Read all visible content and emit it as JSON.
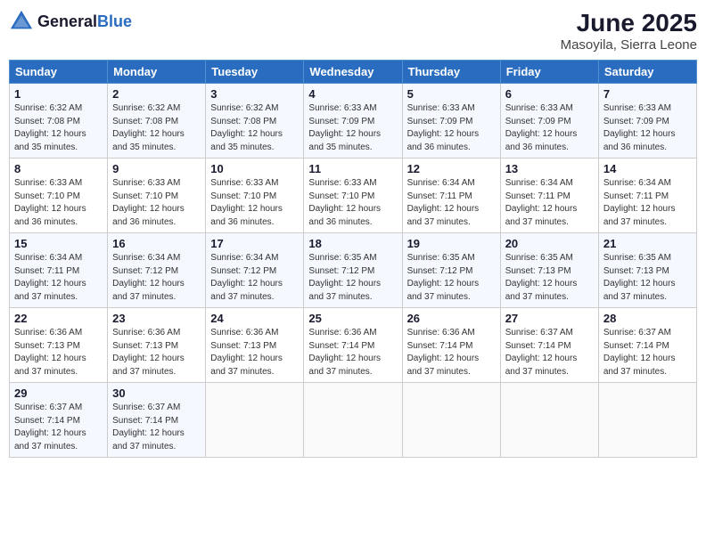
{
  "logo": {
    "general": "General",
    "blue": "Blue"
  },
  "title": "June 2025",
  "subtitle": "Masoyila, Sierra Leone",
  "days_header": [
    "Sunday",
    "Monday",
    "Tuesday",
    "Wednesday",
    "Thursday",
    "Friday",
    "Saturday"
  ],
  "weeks": [
    [
      {
        "day": "1",
        "sunrise": "6:32 AM",
        "sunset": "7:08 PM",
        "daylight": "12 hours and 35 minutes."
      },
      {
        "day": "2",
        "sunrise": "6:32 AM",
        "sunset": "7:08 PM",
        "daylight": "12 hours and 35 minutes."
      },
      {
        "day": "3",
        "sunrise": "6:32 AM",
        "sunset": "7:08 PM",
        "daylight": "12 hours and 35 minutes."
      },
      {
        "day": "4",
        "sunrise": "6:33 AM",
        "sunset": "7:09 PM",
        "daylight": "12 hours and 35 minutes."
      },
      {
        "day": "5",
        "sunrise": "6:33 AM",
        "sunset": "7:09 PM",
        "daylight": "12 hours and 36 minutes."
      },
      {
        "day": "6",
        "sunrise": "6:33 AM",
        "sunset": "7:09 PM",
        "daylight": "12 hours and 36 minutes."
      },
      {
        "day": "7",
        "sunrise": "6:33 AM",
        "sunset": "7:09 PM",
        "daylight": "12 hours and 36 minutes."
      }
    ],
    [
      {
        "day": "8",
        "sunrise": "6:33 AM",
        "sunset": "7:10 PM",
        "daylight": "12 hours and 36 minutes."
      },
      {
        "day": "9",
        "sunrise": "6:33 AM",
        "sunset": "7:10 PM",
        "daylight": "12 hours and 36 minutes."
      },
      {
        "day": "10",
        "sunrise": "6:33 AM",
        "sunset": "7:10 PM",
        "daylight": "12 hours and 36 minutes."
      },
      {
        "day": "11",
        "sunrise": "6:33 AM",
        "sunset": "7:10 PM",
        "daylight": "12 hours and 36 minutes."
      },
      {
        "day": "12",
        "sunrise": "6:34 AM",
        "sunset": "7:11 PM",
        "daylight": "12 hours and 37 minutes."
      },
      {
        "day": "13",
        "sunrise": "6:34 AM",
        "sunset": "7:11 PM",
        "daylight": "12 hours and 37 minutes."
      },
      {
        "day": "14",
        "sunrise": "6:34 AM",
        "sunset": "7:11 PM",
        "daylight": "12 hours and 37 minutes."
      }
    ],
    [
      {
        "day": "15",
        "sunrise": "6:34 AM",
        "sunset": "7:11 PM",
        "daylight": "12 hours and 37 minutes."
      },
      {
        "day": "16",
        "sunrise": "6:34 AM",
        "sunset": "7:12 PM",
        "daylight": "12 hours and 37 minutes."
      },
      {
        "day": "17",
        "sunrise": "6:34 AM",
        "sunset": "7:12 PM",
        "daylight": "12 hours and 37 minutes."
      },
      {
        "day": "18",
        "sunrise": "6:35 AM",
        "sunset": "7:12 PM",
        "daylight": "12 hours and 37 minutes."
      },
      {
        "day": "19",
        "sunrise": "6:35 AM",
        "sunset": "7:12 PM",
        "daylight": "12 hours and 37 minutes."
      },
      {
        "day": "20",
        "sunrise": "6:35 AM",
        "sunset": "7:13 PM",
        "daylight": "12 hours and 37 minutes."
      },
      {
        "day": "21",
        "sunrise": "6:35 AM",
        "sunset": "7:13 PM",
        "daylight": "12 hours and 37 minutes."
      }
    ],
    [
      {
        "day": "22",
        "sunrise": "6:36 AM",
        "sunset": "7:13 PM",
        "daylight": "12 hours and 37 minutes."
      },
      {
        "day": "23",
        "sunrise": "6:36 AM",
        "sunset": "7:13 PM",
        "daylight": "12 hours and 37 minutes."
      },
      {
        "day": "24",
        "sunrise": "6:36 AM",
        "sunset": "7:13 PM",
        "daylight": "12 hours and 37 minutes."
      },
      {
        "day": "25",
        "sunrise": "6:36 AM",
        "sunset": "7:14 PM",
        "daylight": "12 hours and 37 minutes."
      },
      {
        "day": "26",
        "sunrise": "6:36 AM",
        "sunset": "7:14 PM",
        "daylight": "12 hours and 37 minutes."
      },
      {
        "day": "27",
        "sunrise": "6:37 AM",
        "sunset": "7:14 PM",
        "daylight": "12 hours and 37 minutes."
      },
      {
        "day": "28",
        "sunrise": "6:37 AM",
        "sunset": "7:14 PM",
        "daylight": "12 hours and 37 minutes."
      }
    ],
    [
      {
        "day": "29",
        "sunrise": "6:37 AM",
        "sunset": "7:14 PM",
        "daylight": "12 hours and 37 minutes."
      },
      {
        "day": "30",
        "sunrise": "6:37 AM",
        "sunset": "7:14 PM",
        "daylight": "12 hours and 37 minutes."
      },
      null,
      null,
      null,
      null,
      null
    ]
  ]
}
